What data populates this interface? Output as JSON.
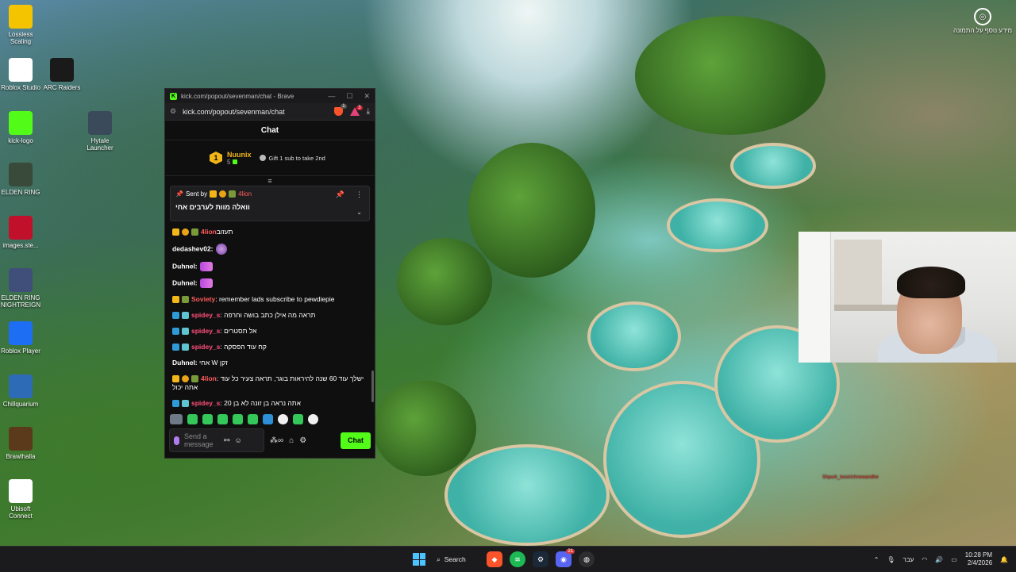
{
  "desktop": {
    "icons": [
      {
        "label": "Lossless Scaling",
        "glyph": "duck-icon",
        "color": "#f5c400"
      },
      {
        "label": "Roblox Studio",
        "glyph": "roblox-studio-icon",
        "color": "#ffffff"
      },
      {
        "label": "ARC Raiders",
        "glyph": "arc-raiders-icon",
        "color": "#1a1a1a"
      },
      {
        "label": "kick-logo",
        "glyph": "kick-logo-icon",
        "color": "#53fc18"
      },
      {
        "label": "Hytale Launcher",
        "glyph": "hytale-icon",
        "color": "#3b4a5a"
      },
      {
        "label": "ELDEN RING",
        "glyph": "elden-ring-icon",
        "color": "#3a4a3a"
      },
      {
        "label": "images.ste...",
        "glyph": "image-icon",
        "color": "#c0102a"
      },
      {
        "label": "ELDEN RING NIGHTREIGN",
        "glyph": "nightreign-icon",
        "color": "#3f4f7a"
      },
      {
        "label": "Roblox Player",
        "glyph": "roblox-player-icon",
        "color": "#1d6ef2"
      },
      {
        "label": "Chillquarium",
        "glyph": "fish-icon",
        "color": "#2e6bb7"
      },
      {
        "label": "Brawlhalla",
        "glyph": "brawlhalla-icon",
        "color": "#5a3a1a"
      },
      {
        "label": "Ubisoft Connect",
        "glyph": "ubisoft-icon",
        "color": "#ffffff"
      }
    ],
    "top_right_widget": "מידע נוסף על התמונה",
    "overlay_text": "Shpurk_bosirichnewandhe"
  },
  "browser": {
    "tab_title": "kick.com/popout/sevenman/chat - Brave",
    "url": "kick.com/popout/sevenman/chat",
    "shield_count": "1",
    "rewards_count": "3"
  },
  "chat": {
    "header": "Chat",
    "top_gifter": {
      "rank": "1",
      "name": "Nuunix",
      "count": "5"
    },
    "gift_prompt": "Gift 1 sub to take 2nd",
    "pinned": {
      "sent_by_label": "Sent by",
      "sender": "4lion",
      "sender_color": "#ff5b5b",
      "text": "וואלה מוות לערבים אחי"
    },
    "messages": [
      {
        "user": "4lion",
        "color": "#ff5b5b",
        "badges": [
          "crown",
          "coin",
          "car"
        ],
        "text": "תעזוב",
        "emote": ""
      },
      {
        "user": "dedashev02:",
        "color": "#ffffff",
        "badges": [],
        "text": "",
        "emote": "emote2"
      },
      {
        "user": "Duhnel:",
        "color": "#ffffff",
        "badges": [],
        "text": "",
        "emote": "emote"
      },
      {
        "user": "Duhnel:",
        "color": "#ffffff",
        "badges": [],
        "text": "",
        "emote": "emote"
      },
      {
        "user": "Soviety",
        "color": "#ff5b5b",
        "badges": [
          "crown",
          "car"
        ],
        "text": ": remember lads subscribe to pewdiepie",
        "emote": ""
      },
      {
        "user": "spidey_s",
        "color": "#ff4f7a",
        "badges": [
          "verify",
          "grid"
        ],
        "text": ": תראה מה אילן כתב בושה וחרפה",
        "emote": ""
      },
      {
        "user": "spidey_s",
        "color": "#ff4f7a",
        "badges": [
          "verify",
          "grid"
        ],
        "text": ": אל תסטרים",
        "emote": ""
      },
      {
        "user": "spidey_s",
        "color": "#ff4f7a",
        "badges": [
          "verify",
          "grid"
        ],
        "text": ": קח עוד הפסקה",
        "emote": ""
      },
      {
        "user": "Duhnel:",
        "color": "#ffffff",
        "badges": [],
        "text": " אחי W זקן",
        "emote": ""
      },
      {
        "user": "4lion",
        "color": "#ff5b5b",
        "badges": [
          "crown",
          "coin",
          "car"
        ],
        "text": ": ישלך עוד 60 שנה להיראות בוגר, תראה צעיר כל עוד אתה יכול",
        "emote": ""
      },
      {
        "user": "spidey_s",
        "color": "#ff4f7a",
        "badges": [
          "verify",
          "grid"
        ],
        "text": ": אתה נראה בן זונה לא בן 20",
        "emote": ""
      }
    ],
    "input_placeholder": "Send a message",
    "send_label": "Chat"
  },
  "taskbar": {
    "search_label": "Search",
    "discord_badge": "21",
    "lang": "עבר",
    "time": "10:28 PM",
    "date": "2/4/2026"
  }
}
